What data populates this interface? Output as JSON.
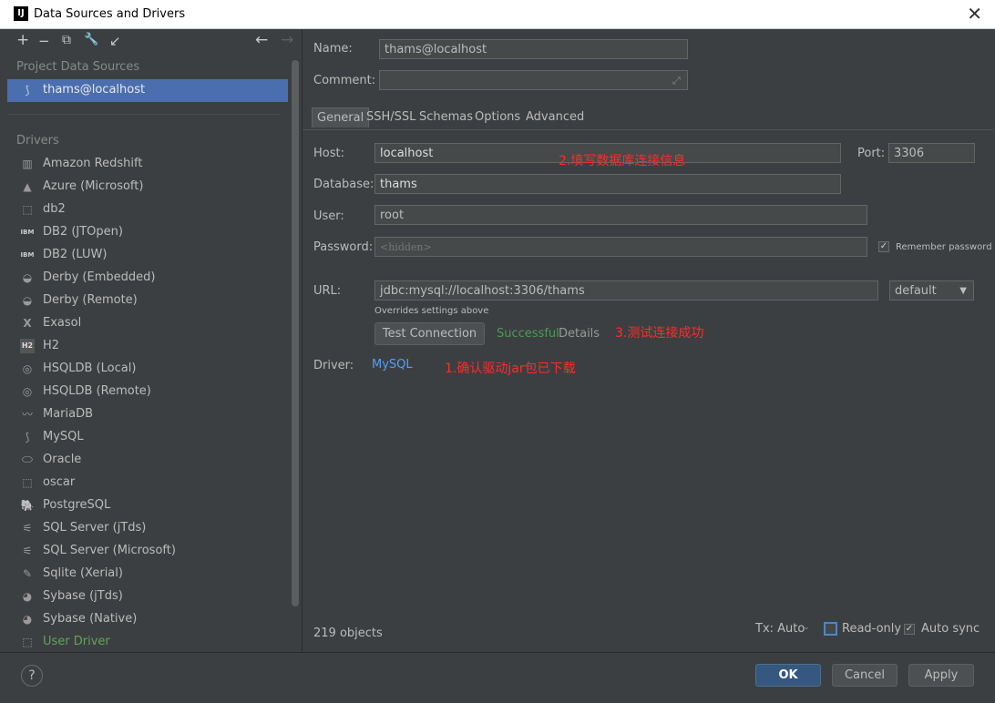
{
  "window": {
    "title": "Data Sources and Drivers",
    "app_icon_text": "IJ"
  },
  "toolbar": {
    "add": "+",
    "remove": "−",
    "copy": "⧉",
    "settings": "🔧",
    "import": "↙",
    "back": "←",
    "forward": "→"
  },
  "project": {
    "heading": "Project Data Sources",
    "items": [
      {
        "label": "thams@localhost",
        "icon": "mysql-icon"
      }
    ]
  },
  "drivers": {
    "heading": "Drivers",
    "items": [
      {
        "label": "Amazon Redshift",
        "icon": "redshift-icon"
      },
      {
        "label": "Azure (Microsoft)",
        "icon": "azure-icon"
      },
      {
        "label": "db2",
        "icon": "db2-icon"
      },
      {
        "label": "DB2 (JTOpen)",
        "icon": "ibm-db2-icon"
      },
      {
        "label": "DB2 (LUW)",
        "icon": "ibm-db2-icon"
      },
      {
        "label": "Derby (Embedded)",
        "icon": "derby-icon"
      },
      {
        "label": "Derby (Remote)",
        "icon": "derby-icon"
      },
      {
        "label": "Exasol",
        "icon": "exasol-icon"
      },
      {
        "label": "H2",
        "icon": "h2-icon"
      },
      {
        "label": "HSQLDB (Local)",
        "icon": "hsqldb-icon"
      },
      {
        "label": "HSQLDB (Remote)",
        "icon": "hsqldb-icon"
      },
      {
        "label": "MariaDB",
        "icon": "mariadb-icon"
      },
      {
        "label": "MySQL",
        "icon": "mysql-icon"
      },
      {
        "label": "Oracle",
        "icon": "oracle-icon"
      },
      {
        "label": "oscar",
        "icon": "oscar-icon"
      },
      {
        "label": "PostgreSQL",
        "icon": "postgresql-icon"
      },
      {
        "label": "SQL Server (jTds)",
        "icon": "sqlserver-icon"
      },
      {
        "label": "SQL Server (Microsoft)",
        "icon": "sqlserver-icon"
      },
      {
        "label": "Sqlite (Xerial)",
        "icon": "sqlite-icon"
      },
      {
        "label": "Sybase (jTds)",
        "icon": "sybase-icon"
      },
      {
        "label": "Sybase (Native)",
        "icon": "sybase-icon"
      },
      {
        "label": "User Driver",
        "icon": "user-driver-icon"
      }
    ]
  },
  "form": {
    "name_label": "Name:",
    "name_value": "thams@localhost",
    "comment_label": "Comment:",
    "comment_value": "",
    "tabs": [
      {
        "label": "General"
      },
      {
        "label": "SSH/SSL"
      },
      {
        "label": "Schemas"
      },
      {
        "label": "Options"
      },
      {
        "label": "Advanced"
      }
    ],
    "host_label": "Host:",
    "host_value": "localhost",
    "port_label": "Port:",
    "port_value": "3306",
    "database_label": "Database:",
    "database_value": "thams",
    "user_label": "User:",
    "user_value": "root",
    "password_label": "Password:",
    "password_placeholder": "<hidden>",
    "remember_password": "Remember password",
    "url_label": "URL:",
    "url_value": "jdbc:mysql://localhost:3306/thams",
    "url_mode": "default",
    "url_hint": "Overrides settings above",
    "test_connection": "Test Connection",
    "test_status": "Successful",
    "details": "Details",
    "driver_label": "Driver:",
    "driver_value": "MySQL"
  },
  "annotations": {
    "note1": "1.确认驱动jar包已下载",
    "note2": "2.填写数据库连接信息",
    "note3": "3.测试连接成功"
  },
  "status": {
    "objects": "219 objects",
    "tx": "Tx: Auto",
    "read_only": "Read-only",
    "auto_sync": "Auto sync"
  },
  "footer": {
    "help": "?",
    "ok": "OK",
    "cancel": "Cancel",
    "apply": "Apply"
  },
  "colors": {
    "background": "#3c3f41",
    "selection": "#4b6eaf",
    "success": "#499c54",
    "link": "#589df6",
    "annotation": "#ff2b2b",
    "primary_button": "#365880"
  }
}
